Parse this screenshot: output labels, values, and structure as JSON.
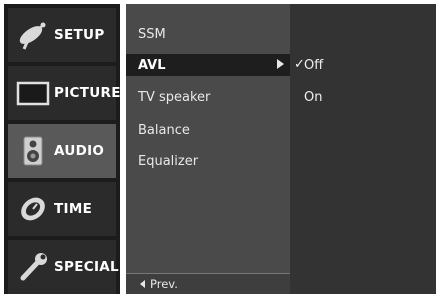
{
  "categories": [
    {
      "label": "SETUP",
      "icon": "satellite-dish-icon"
    },
    {
      "label": "PICTURE",
      "icon": "monitor-icon"
    },
    {
      "label": "AUDIO",
      "icon": "speaker-icon"
    },
    {
      "label": "TIME",
      "icon": "clock-icon"
    },
    {
      "label": "SPECIAL",
      "icon": "wrench-icon"
    }
  ],
  "active_category": "AUDIO",
  "submenu": {
    "items": [
      "SSM",
      "AVL",
      "TV speaker",
      "Balance",
      "Equalizer"
    ],
    "selected": "AVL",
    "prev_label": "Prev."
  },
  "options": {
    "items": [
      "Off",
      "On"
    ],
    "checked": "Off",
    "check_mark": "✓"
  },
  "colors": {
    "menu_bg": "#1c1c1c",
    "active_category_bg": "#595959",
    "submenu_bg": "#4a4a4a",
    "selected_item_bg": "#1e1e1e",
    "options_bg": "#333333",
    "text": "#ffffff"
  }
}
